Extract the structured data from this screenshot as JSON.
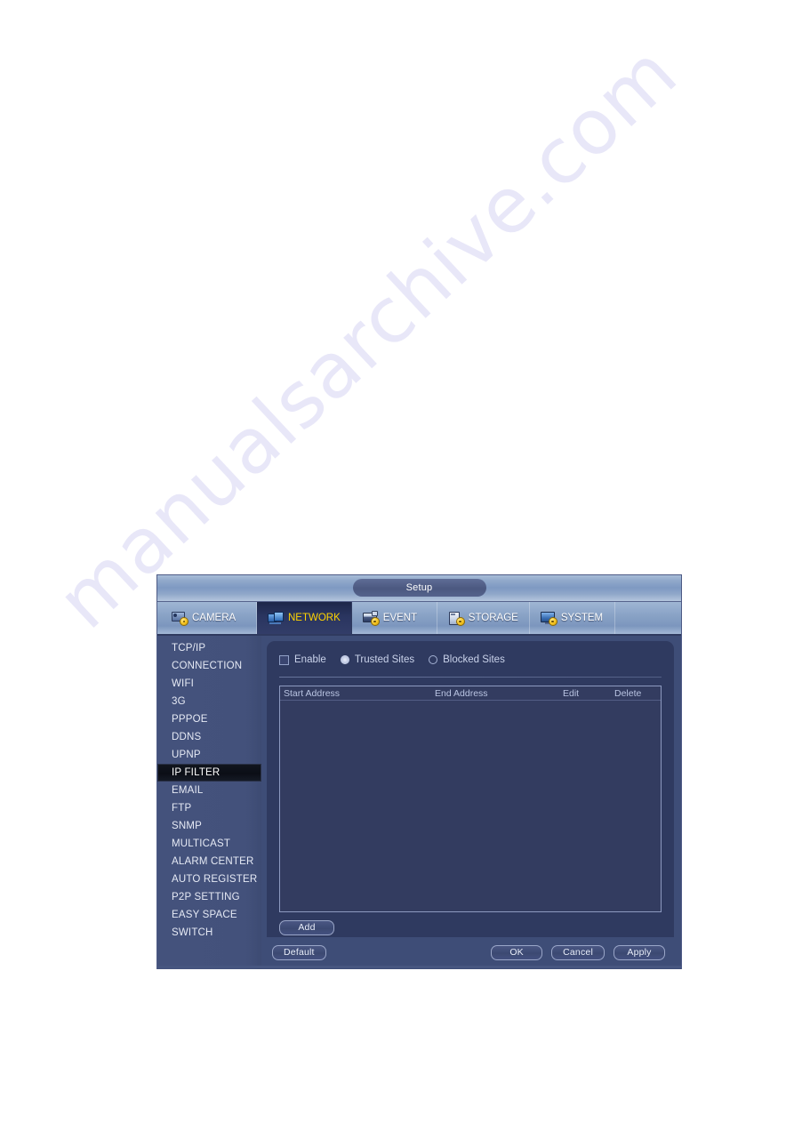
{
  "page": {
    "watermark_text": "manualsarchive.com"
  },
  "dialog": {
    "title": "Setup",
    "tabs": [
      {
        "label": "CAMERA",
        "icon": "camera-icon",
        "active": false
      },
      {
        "label": "NETWORK",
        "icon": "network-icon",
        "active": true
      },
      {
        "label": "EVENT",
        "icon": "event-icon",
        "active": false
      },
      {
        "label": "STORAGE",
        "icon": "storage-icon",
        "active": false
      },
      {
        "label": "SYSTEM",
        "icon": "system-icon",
        "active": false
      }
    ],
    "sidebar": {
      "items": [
        {
          "label": "TCP/IP",
          "active": false
        },
        {
          "label": "CONNECTION",
          "active": false
        },
        {
          "label": "WIFI",
          "active": false
        },
        {
          "label": "3G",
          "active": false
        },
        {
          "label": "PPPOE",
          "active": false
        },
        {
          "label": "DDNS",
          "active": false
        },
        {
          "label": "UPNP",
          "active": false
        },
        {
          "label": "IP FILTER",
          "active": true
        },
        {
          "label": "EMAIL",
          "active": false
        },
        {
          "label": "FTP",
          "active": false
        },
        {
          "label": "SNMP",
          "active": false
        },
        {
          "label": "MULTICAST",
          "active": false
        },
        {
          "label": "ALARM CENTER",
          "active": false
        },
        {
          "label": "AUTO REGISTER",
          "active": false
        },
        {
          "label": "P2P SETTING",
          "active": false
        },
        {
          "label": "EASY SPACE",
          "active": false
        },
        {
          "label": "SWITCH",
          "active": false
        }
      ]
    },
    "main": {
      "enable_label": "Enable",
      "enable_checked": false,
      "site_mode": "Trusted Sites",
      "radios": [
        {
          "label": "Trusted Sites",
          "selected": true
        },
        {
          "label": "Blocked Sites",
          "selected": false
        }
      ],
      "table": {
        "columns": [
          "Start Address",
          "End Address",
          "Edit",
          "Delete"
        ],
        "rows": []
      },
      "add_label": "Add"
    },
    "footer": {
      "default_label": "Default",
      "ok_label": "OK",
      "cancel_label": "Cancel",
      "apply_label": "Apply"
    },
    "colors": {
      "accent_active_tab_text": "#ffd400",
      "panel_bg": "#2f3a60",
      "sidebar_bg": "#44527c",
      "table_bg": "#333c60",
      "sidebar_active_bg": "#0b0e16"
    }
  }
}
